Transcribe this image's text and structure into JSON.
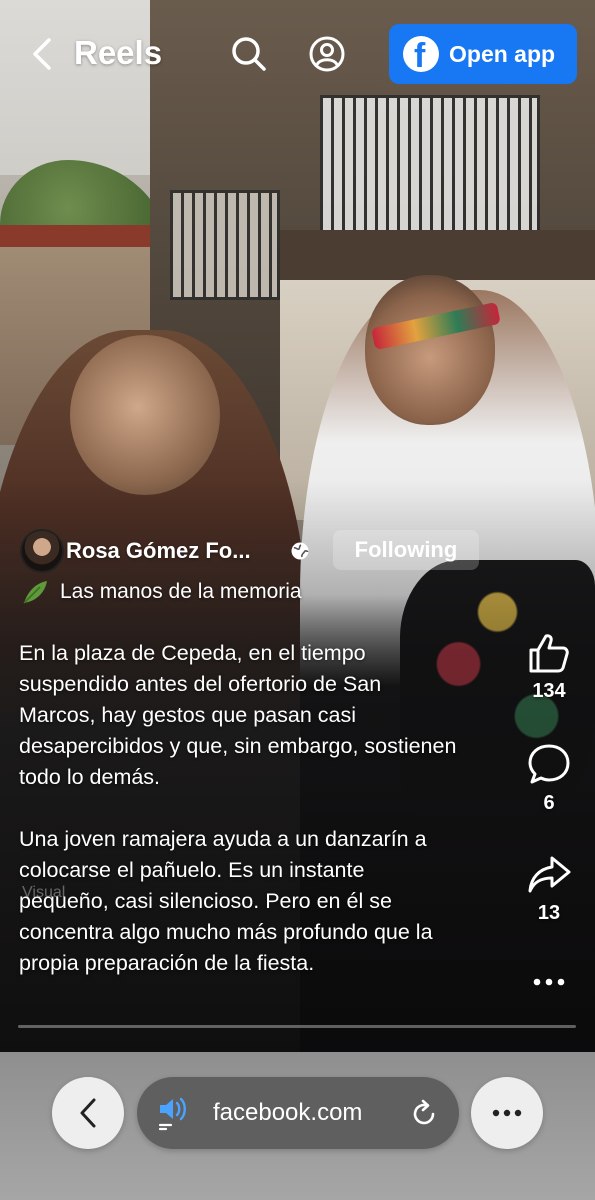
{
  "header": {
    "title": "Reels",
    "back_icon": "chevron-left-icon",
    "search_icon": "search-icon",
    "profile_icon": "user-circle-icon",
    "open_app_label": "Open app",
    "brand_color": "#1877f2"
  },
  "post": {
    "author_name": "Rosa Gómez Fo...",
    "privacy_icon": "globe-icon",
    "follow_label": "Following",
    "audio_icon": "leaf-emoji-icon",
    "audio_title": "Las manos de la memoria",
    "caption_paragraphs": [
      "En la plaza de Cepeda, en el tiempo suspendido antes del ofertorio de San Marcos, hay gestos que pasan casi desapercibidos y que, sin embargo, sostienen todo lo demás.",
      "Una joven ramajera ayuda a un danzarín a colocarse el pañuelo. Es un instante pequeño, casi silencioso. Pero en él se concentra algo mucho más profundo que la propia preparación de la fiesta."
    ],
    "watermark": "Visual"
  },
  "rail": {
    "like_count": "134",
    "comment_count": "6",
    "share_count": "13",
    "more_icon": "ellipsis-icon"
  },
  "browser": {
    "url": "facebook.com",
    "back_icon": "chevron-left-icon",
    "audio_icon": "speaker-icon",
    "reload_icon": "reload-icon",
    "more_icon": "ellipsis-icon"
  }
}
